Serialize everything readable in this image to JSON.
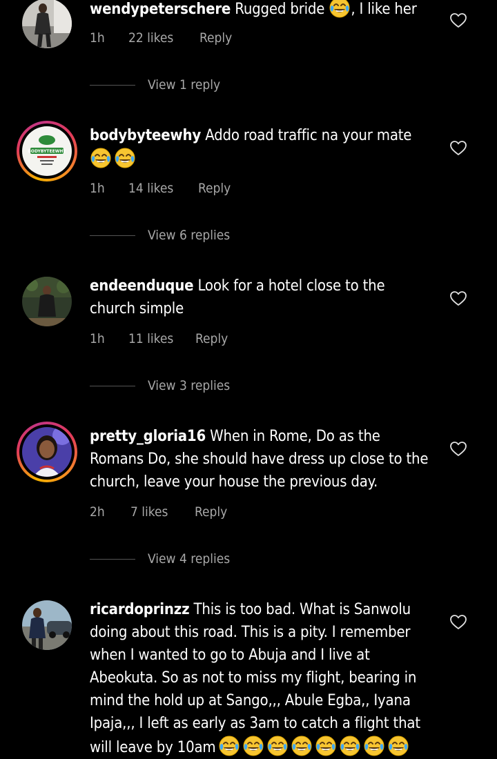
{
  "comments": [
    {
      "username": "wendypeterschere",
      "text_before": " Rugged bride ",
      "emoji_count": 1,
      "text_after": ", I like her",
      "time": "1h",
      "likes": "22 likes",
      "reply": "Reply",
      "view_replies": "View 1 reply",
      "avatar": "woman-standing-photo"
    },
    {
      "username": "bodybyteewhy",
      "text_before": " Addo road traffic na your mate",
      "emoji_count": 2,
      "text_after": "",
      "time": "1h",
      "likes": "14 likes",
      "reply": "Reply",
      "view_replies": "View 6 replies",
      "avatar": "bodybyteewhy-logo",
      "logo_text": "BODYBYTEEWHY",
      "has_story_ring": true
    },
    {
      "username": "endeenduque",
      "text_before": " Look for a hotel close to the church simple",
      "emoji_count": 0,
      "text_after": "",
      "time": "1h",
      "likes": "11 likes",
      "reply": "Reply",
      "view_replies": "View 3 replies",
      "avatar": "man-in-suit-photo"
    },
    {
      "username": "pretty_gloria16",
      "text_before": " When in Rome, Do as the Romans Do, she should have dress up close to the church, leave your house the previous day.",
      "emoji_count": 0,
      "text_after": "",
      "time": "2h",
      "likes": "7 likes",
      "reply": "Reply",
      "view_replies": "View 4 replies",
      "avatar": "woman-portrait-photo",
      "has_story_ring": true
    },
    {
      "username": "ricardoprinzz",
      "text_before": " This is too bad. What is Sanwolu doing about this road. This is a pity. I remember when I wanted to go to Abuja and I live at Abeokuta. So as not to miss my flight, bearing in mind the hold up at Sango,,, Abule Egba,, Iyana Ipaja,,, I left as early as 3am to catch a flight that will leave by 10am",
      "emoji_count": 8,
      "text_after": "",
      "avatar": "man-with-car-photo"
    }
  ],
  "colors": {
    "background": "#000000",
    "text": "#ffffff",
    "secondary": "#a8a8a8",
    "ring_start": "#f5b100",
    "ring_end": "#c13584"
  },
  "icons": {
    "like": "heart-outline-icon",
    "emoji": "face-with-tears-of-joy"
  }
}
